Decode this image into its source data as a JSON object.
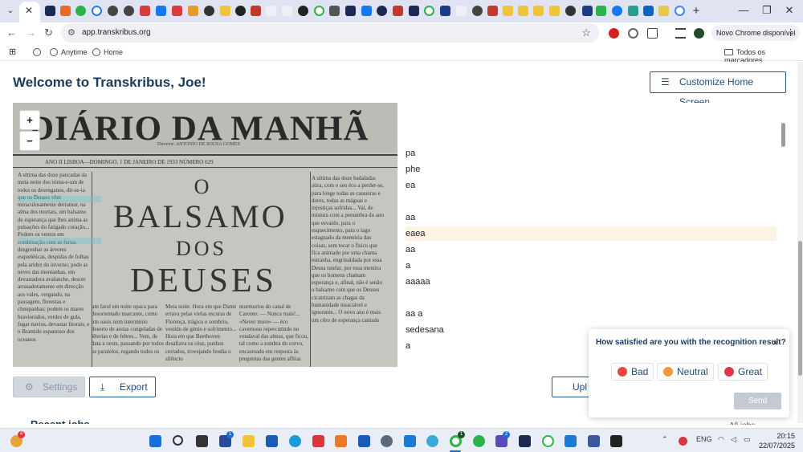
{
  "browser": {
    "url": "app.transkribus.org",
    "update_button": "Novo Chrome disponível",
    "new_tab_symbol": "+",
    "window_controls": [
      "—",
      "❐",
      "✕"
    ],
    "tab_close": "✕"
  },
  "bookmarks": {
    "items": [
      "Anytime",
      "Home"
    ],
    "all_bookmarks": "Todos os marcadores"
  },
  "page": {
    "welcome": "Welcome to Transkribus, Joe!",
    "customize_button": "Customize Home Screen",
    "settings_button": "Settings",
    "export_button": "Export",
    "upload_button": "Upl",
    "recent_heading": "Recent jobs",
    "all_link": "All jobs"
  },
  "scan": {
    "masthead": "DIÁRIO DA MANHÃ",
    "director": "Director: ANTONIO DE SOUSA GOMES",
    "dateline": "ANO II    LISBOA—DOMINGO, 1 DE JANEIRO DE 1933    NÚMERO 629",
    "headline_1": "O",
    "headline_2": "BALSAMO",
    "headline_3": "DOS",
    "headline_4": "DEUSES",
    "col_left": "A ultima das doze pancadas da meia noite dos trinta-e-um de todos os desenganos, dir-se-ia que os Deuses vêm miraculosamente derramar, na alma dos mortais, um balsamo de esperança que lhes anima as pulsações do fatigado coração... Podem os ventos em combinação com as furias desgrenhar as árvores esqueléticas, despidas de folhas pela aridez do inverno; pode as neves das montanhas, em devastadora avalanche, descer arrasadoramente em direcção aos vales, vergando, na passagem, florestas e choupanhas; podem os mares braviorudos, verdes de gula, fugar navios, devastar litorais, e o Bramido espantoso dos oceanos",
    "col_bottom": "um farol em noite opaca para desorientado marcante, como um oasis num interminio deserto de areias congeladas de lêterias e de febres... Vem, de data a oeste, passando por todos os paralelos, regando todos os",
    "col_mid": "Meia noite. Hora em que Dante errava pelas vielas escuras de Florença, trágico e sombrio, vestido de génio e sofrimento... Hora em que Beethoven desafiava os céus, punhos cerrados, trovejando fendia o silêncio",
    "col_mid2": "murmurios do canal de Caronte: — Nunca mais!... «Never more» — éco cavernoso repercutindo no vendaval das almas, que ficou, tal como a sombra do corvo, encastoado em resposta às preguntas das gentes aflitas",
    "col_right": "A ultima das doze badaladas atira, com o seu éco a perder-se, para longe todas as canseiras e dores, todas as mágoas e injustiças sofridas... Vai, de mistura com a penumbra do ano que esvaído, para o esquecimento, para o lago estagnado da memória das coisas, sem tocar o físico que fica animado por uma chama estranha, engrinaldada por essa Deusa tutelar, por essa mentira que os homens chamam esperança e, afinal, não é senão o balsamo com que os Deuses cicatrizam as chagas da humanidade insaciável e ignorante... O novo ano é mais um côro de esperança cantado",
    "zoom_in": "+",
    "zoom_out": "−"
  },
  "transcript": {
    "lines": [
      "pa",
      "phe",
      "ea",
      "",
      "aa",
      "eaea",
      "aa",
      "a",
      "aaaaa",
      "",
      "aa a",
      "sedesana",
      "a"
    ],
    "selected_index": 5
  },
  "survey": {
    "question": "How satisfied are you with the recognition result?",
    "close": "×",
    "options": [
      {
        "label": "Bad",
        "color": "#e8483c"
      },
      {
        "label": "Neutral",
        "color": "#f29a3a"
      },
      {
        "label": "Great",
        "color": "#e0384a"
      }
    ],
    "send": "Send"
  },
  "taskbar": {
    "language": "ENG",
    "time": "20:15",
    "date": "22/07/2025",
    "badges": [
      "4",
      "1",
      "1",
      "2",
      "1"
    ]
  },
  "colors": {
    "brand_navy": "#1a3a5c",
    "accent_blue": "#1d4b7a",
    "selected_line": "#fdf2e3"
  }
}
